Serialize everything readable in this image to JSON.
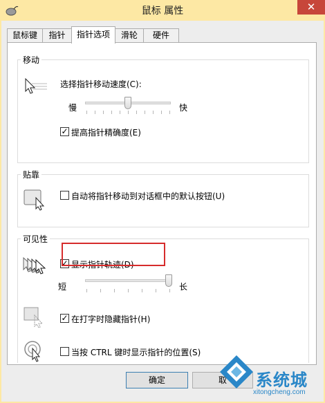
{
  "window": {
    "title": "鼠标 属性",
    "close_glyph": "✕",
    "app_icon": "mouse-icon"
  },
  "tabs": [
    {
      "label": "鼠标键",
      "active": false
    },
    {
      "label": "指针",
      "active": false
    },
    {
      "label": "指针选项",
      "active": true
    },
    {
      "label": "滑轮",
      "active": false
    },
    {
      "label": "硬件",
      "active": false
    }
  ],
  "motion": {
    "group_label": "移动",
    "speed_label": "选择指针移动速度(C):",
    "slow_label": "慢",
    "fast_label": "快",
    "speed_level": 0.5,
    "precision_label": "提高指针精确度(E)",
    "precision_checked": true,
    "icon": "pointer-speed-icon"
  },
  "snap": {
    "group_label": "贴靠",
    "snap_label": "自动将指针移动到对话框中的默认按钮(U)",
    "snap_checked": false,
    "icon": "snap-to-button-icon"
  },
  "visibility": {
    "group_label": "可见性",
    "trails_label": "显示指针轨迹(D)",
    "trails_checked": true,
    "short_label": "短",
    "long_label": "长",
    "trail_level": 1.0,
    "hide_label": "在打字时隐藏指针(H)",
    "hide_checked": true,
    "ctrl_label": "当按 CTRL 键时显示指针的位置(S)",
    "ctrl_checked": false
  },
  "buttons": {
    "ok_label": "确定",
    "cancel_label": "取"
  },
  "watermark": {
    "text": "系统城",
    "site": "xitongcheng.com"
  },
  "colors": {
    "titlebar": "#fde8a4",
    "close": "#c7463a",
    "highlight": "#d62b2b",
    "watermark": "#2a87c8"
  }
}
